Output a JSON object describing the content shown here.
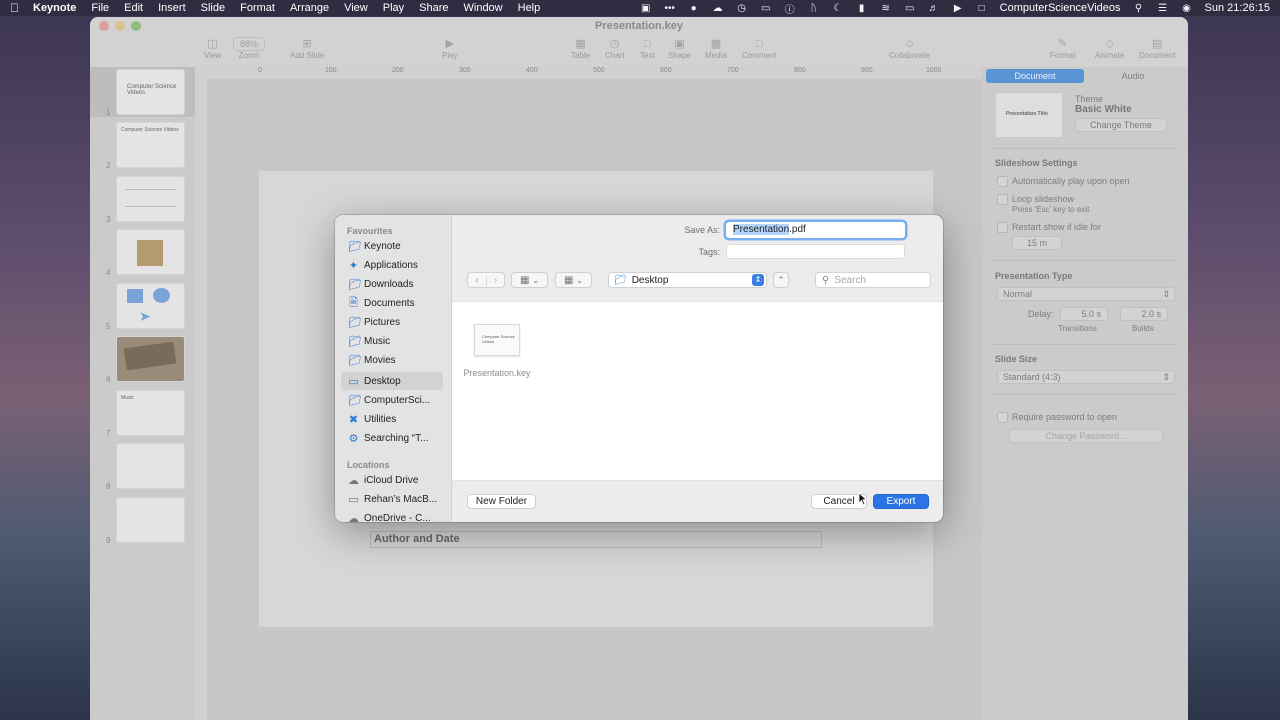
{
  "menubar": {
    "app_name": "Keynote",
    "menus": [
      "File",
      "Edit",
      "Insert",
      "Slide",
      "Format",
      "Arrange",
      "View",
      "Play",
      "Share",
      "Window",
      "Help"
    ],
    "user_label": "ComputerScienceVideos",
    "clock": "Sun  21:26:15"
  },
  "window": {
    "title": "Presentation.key",
    "toolbar": {
      "view": "View",
      "zoom": "Zoom",
      "zoom_value": "88%",
      "add_slide": "Add Slide",
      "play": "Play",
      "table": "Table",
      "chart": "Chart",
      "text": "Text",
      "shape": "Shape",
      "media": "Media",
      "comment": "Comment",
      "collaborate": "Collaborate",
      "format": "Format",
      "animate": "Animate",
      "document": "Document"
    },
    "ruler_ticks": [
      "0",
      "100",
      "200",
      "300",
      "400",
      "500",
      "600",
      "700",
      "800",
      "900",
      "1000"
    ],
    "slides": [
      {
        "num": "1",
        "text": "Computer Science Videos"
      },
      {
        "num": "2",
        "text": "Computer Science Videos"
      },
      {
        "num": "3",
        "text": ""
      },
      {
        "num": "4",
        "text": ""
      },
      {
        "num": "5",
        "text": ""
      },
      {
        "num": "6",
        "text": ""
      },
      {
        "num": "7",
        "text": "Music"
      },
      {
        "num": "8",
        "text": ""
      },
      {
        "num": "9",
        "text": ""
      }
    ],
    "slide_author_text": "Author and Date"
  },
  "inspector": {
    "tab_document": "Document",
    "tab_audio": "Audio",
    "theme_label": "Theme",
    "theme_name": "Basic White",
    "theme_preview_title": "Presentation Title",
    "change_theme": "Change Theme",
    "slideshow_settings": "Slideshow Settings",
    "auto_play": "Automatically play upon open",
    "loop": "Loop slideshow",
    "loop_hint": "Press 'Esc' key to exit",
    "restart_idle": "Restart show if idle for",
    "idle_value": "15 m",
    "presentation_type": "Presentation Type",
    "type_value": "Normal",
    "delay_label": "Delay:",
    "transitions_value": "5.0 s",
    "builds_value": "2.0 s",
    "transitions_label": "Transitions",
    "builds_label": "Builds",
    "slide_size": "Slide Size",
    "slide_size_value": "Standard (4:3)",
    "require_password": "Require password to open",
    "change_password": "Change Password..."
  },
  "dialog": {
    "sidebar": {
      "favourites_header": "Favourites",
      "favourites": [
        {
          "label": "Keynote",
          "icon": "folder-icon"
        },
        {
          "label": "Applications",
          "icon": "applications-icon"
        },
        {
          "label": "Downloads",
          "icon": "folder-icon"
        },
        {
          "label": "Documents",
          "icon": "document-icon"
        },
        {
          "label": "Pictures",
          "icon": "folder-icon"
        },
        {
          "label": "Music",
          "icon": "folder-icon"
        },
        {
          "label": "Movies",
          "icon": "folder-icon"
        },
        {
          "label": "Desktop",
          "icon": "desktop-icon"
        },
        {
          "label": "ComputerSci...",
          "icon": "folder-icon"
        },
        {
          "label": "Utilities",
          "icon": "utilities-icon"
        },
        {
          "label": "Searching “T...",
          "icon": "gear-icon"
        }
      ],
      "locations_header": "Locations",
      "locations": [
        {
          "label": "iCloud Drive",
          "icon": "cloud-icon"
        },
        {
          "label": "Rehan’s MacB...",
          "icon": "laptop-icon"
        },
        {
          "label": "OneDrive - C...",
          "icon": "cloud-icon"
        }
      ]
    },
    "save_as_label": "Save As:",
    "filename_selected": "Presentation",
    "filename_ext": ".pdf",
    "tags_label": "Tags:",
    "location": "Desktop",
    "search_placeholder": "Search",
    "files": [
      {
        "name": "Presentation.key",
        "preview_text": "Computer Science Videos"
      }
    ],
    "new_folder": "New Folder",
    "cancel": "Cancel",
    "export": "Export"
  }
}
